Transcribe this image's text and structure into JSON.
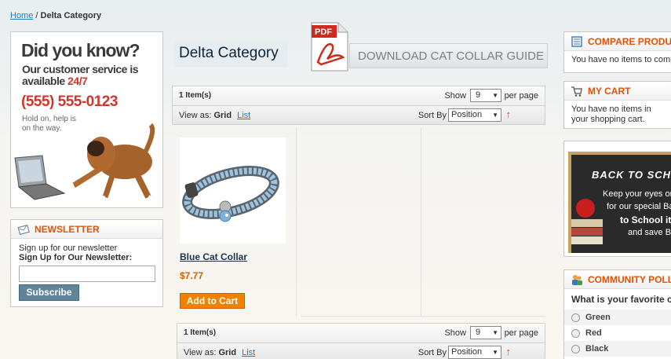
{
  "breadcrumb": {
    "home": "Home",
    "sep": "/",
    "current": "Delta Category"
  },
  "ad": {
    "headline": "Did you know?",
    "line1": "Our customer service is",
    "line2_prefix": "available",
    "line2_hours": "24/7",
    "phone": "(555) 555-0123",
    "hold": "Hold on, help is on the way."
  },
  "newsletter": {
    "title": "NEWSLETTER",
    "line1": "Sign up for our newsletter",
    "line2": "Sign Up for Our Newsletter:",
    "email_value": "",
    "button": "Subscribe"
  },
  "main": {
    "title": "Delta Category",
    "pdf_label": "PDF",
    "download": "DOWNLOAD CAT COLLAR GUIDE"
  },
  "toolbar": {
    "items": "1 Item(s)",
    "show": "Show",
    "limit": "9",
    "per_page": "per page",
    "view_as": "View as:",
    "view_grid": "Grid",
    "view_list": "List",
    "sort_by": "Sort By",
    "sort_value": "Position",
    "sort_arrow": "↑"
  },
  "product": {
    "name": "Blue Cat Collar",
    "price": "$7.77",
    "add_to_cart": "Add to Cart"
  },
  "compare": {
    "title": "COMPARE PRODUCTS",
    "text": "You have no items to compare."
  },
  "cart": {
    "title": "MY CART",
    "text": "You have no items in your shopping cart."
  },
  "promo": {
    "title": "BACK TO SCHOOL",
    "l1": "Keep your eyes on",
    "l2": "for our special Back",
    "l3": "to School items",
    "l4": "and save B"
  },
  "poll": {
    "title": "COMMUNITY POLL",
    "question": "What is your favorite color",
    "options": [
      "Green",
      "Red",
      "Black"
    ]
  },
  "colors": {
    "accent": "#e25203",
    "link": "#1e7ec8",
    "button": "#618499",
    "cart": "#f18200",
    "price": "#c76200"
  }
}
